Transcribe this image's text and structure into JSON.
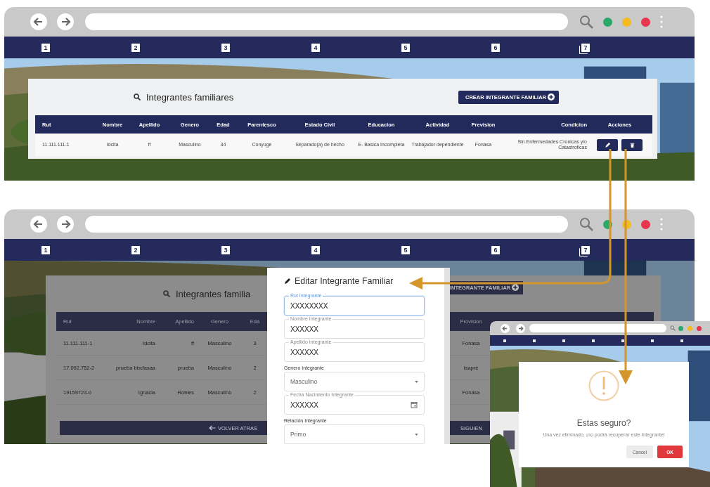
{
  "screen_list": {
    "nav": [
      {
        "label": "1",
        "kind": "plain"
      },
      {
        "label": "2",
        "kind": "plain"
      },
      {
        "label": "3",
        "kind": "plain"
      },
      {
        "label": "4",
        "kind": "plain"
      },
      {
        "label": "5",
        "kind": "plain"
      },
      {
        "label": "6",
        "kind": "plain"
      },
      {
        "label": "7",
        "kind": "stacked"
      }
    ],
    "title": "Integrantes familiares",
    "create_button": "CREAR INTEGRANTE FAMILIAR",
    "columns": [
      "Rut",
      "Nombre",
      "Apellido",
      "Genero",
      "Edad",
      "Parentesco",
      "Estado Civil",
      "Educacion",
      "Actividad",
      "Prevision",
      "Condicion",
      "Acciones"
    ],
    "rows": [
      {
        "cells": [
          "11.111.111-1",
          "Idcita",
          "ff",
          "Masculino",
          "34",
          "Conyuge",
          "Separado(a) de hecho",
          "E. Basica Incompleta",
          "Trabajador dependiente",
          "Fonasa",
          "Sin Enfermedades Cronicas y/o Catastroficas"
        ]
      }
    ]
  },
  "screen_edit": {
    "nav": [
      {
        "label": "1",
        "kind": "plain"
      },
      {
        "label": "2",
        "kind": "plain"
      },
      {
        "label": "3",
        "kind": "plain"
      },
      {
        "label": "4",
        "kind": "plain"
      },
      {
        "label": "5",
        "kind": "plain"
      },
      {
        "label": "6",
        "kind": "plain"
      },
      {
        "label": "7",
        "kind": "stacked"
      }
    ],
    "title": "Integrantes familia",
    "create_button": "INTEGRANTE FAMILIAR",
    "left_columns": [
      "Rut",
      "Nombre",
      "Apellido",
      "Genero",
      "Eda"
    ],
    "right_columns": [
      "Provision"
    ],
    "rows": [
      {
        "left_cells": [
          "11.111.111-1",
          "Idcita",
          "ff",
          "Masculino",
          "3"
        ],
        "right_cells": [
          "Fonasa"
        ]
      },
      {
        "left_cells": [
          "17.092.752-2",
          "prueba bbcfasaa",
          "prueba",
          "Masculino",
          "2"
        ],
        "right_cells": [
          "Isapre"
        ]
      },
      {
        "left_cells": [
          "19159723-0",
          "Ignacia",
          "Robles",
          "Masculino",
          "2"
        ],
        "right_cells": [
          "Fonasa"
        ]
      }
    ],
    "back_button": "VOLVER ATRAS",
    "next_button": "SIGUIEN",
    "form": {
      "title": "Editar Integrante Familiar",
      "fields": [
        {
          "kind": "text",
          "label": "Rut Integrante",
          "value": "XXXXXXXX",
          "focused": true
        },
        {
          "kind": "text",
          "label": "Nombre Integrante",
          "value": "XXXXXX",
          "focused": false
        },
        {
          "kind": "text",
          "label": "Apellido Integrante",
          "value": "XXXXXX",
          "focused": false
        },
        {
          "kind": "select",
          "label": "Genero Integrante",
          "value": "Masculino",
          "focused": false
        },
        {
          "kind": "date",
          "label": "Fecha Nacimiento Integrante",
          "value": "XXXXXX",
          "focused": false
        },
        {
          "kind": "select",
          "label": "Relación Integrante",
          "value": "Primo",
          "focused": false
        }
      ]
    }
  },
  "screen_delete": {
    "dialog": {
      "title": "Estas seguro?",
      "message": "Una vez eliminado, ¡no podrá recuperar este integrante!",
      "cancel": "Cancel",
      "ok": "OK"
    }
  }
}
